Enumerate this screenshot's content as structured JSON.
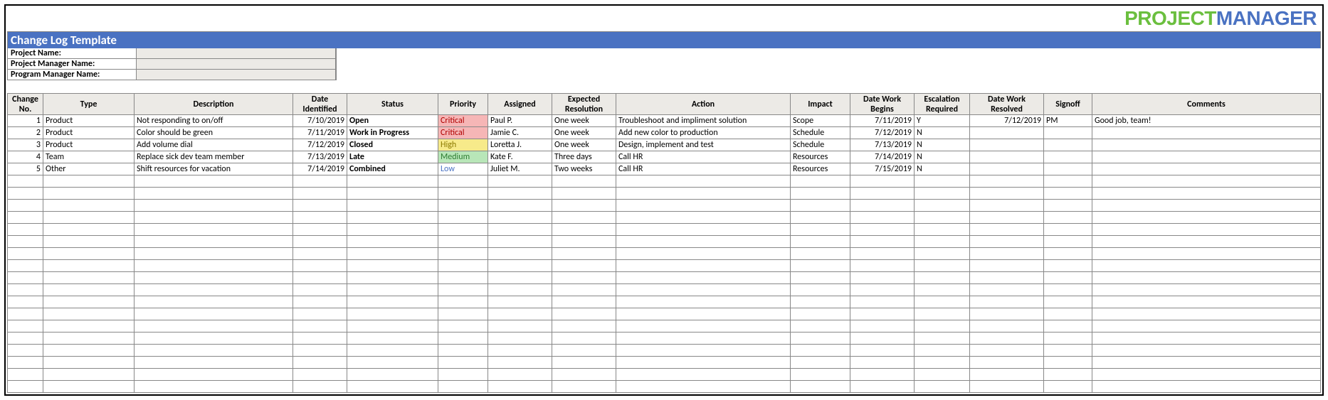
{
  "brand": {
    "part1": "PROJECT",
    "part2": "MANAGER"
  },
  "title": "Change Log Template",
  "meta": {
    "project_label": "Project Name:",
    "project_value": "",
    "pm_label": "Project Manager Name:",
    "pm_value": "",
    "program_label": "Program Manager Name:",
    "program_value": ""
  },
  "headers": {
    "change_no": "Change No.",
    "type": "Type",
    "description": "Description",
    "date_identified": "Date Identified",
    "status": "Status",
    "priority": "Priority",
    "assigned": "Assigned",
    "expected_resolution": "Expected Resolution",
    "action": "Action",
    "impact": "Impact",
    "date_work_begins": "Date Work Begins",
    "escalation_required": "Escalation Required",
    "date_work_resolved": "Date Work Resolved",
    "signoff": "Signoff",
    "comments": "Comments"
  },
  "rows": [
    {
      "no": "1",
      "type": "Product",
      "description": "Not responding to on/off",
      "date_identified": "7/10/2019",
      "status": "Open",
      "priority": "Critical",
      "assigned": "Paul P.",
      "expected": "One week",
      "action": "Troubleshoot and impliment solution",
      "impact": "Scope",
      "work_begins": "7/11/2019",
      "escalation": "Y",
      "work_resolved": "7/12/2019",
      "signoff": "PM",
      "comments": "Good job, team!"
    },
    {
      "no": "2",
      "type": "Product",
      "description": "Color should be green",
      "date_identified": "7/11/2019",
      "status": "Work in Progress",
      "priority": "Critical",
      "assigned": "Jamie C.",
      "expected": "One week",
      "action": "Add new color to production",
      "impact": "Schedule",
      "work_begins": "7/12/2019",
      "escalation": "N",
      "work_resolved": "",
      "signoff": "",
      "comments": ""
    },
    {
      "no": "3",
      "type": "Product",
      "description": "Add volume dial",
      "date_identified": "7/12/2019",
      "status": "Closed",
      "priority": "High",
      "assigned": "Loretta J.",
      "expected": "One week",
      "action": "Design, implement and test",
      "impact": "Schedule",
      "work_begins": "7/13/2019",
      "escalation": "N",
      "work_resolved": "",
      "signoff": "",
      "comments": ""
    },
    {
      "no": "4",
      "type": "Team",
      "description": "Replace sick dev team member",
      "date_identified": "7/13/2019",
      "status": "Late",
      "priority": "Medium",
      "assigned": "Kate F.",
      "expected": "Three days",
      "action": "Call HR",
      "impact": "Resources",
      "work_begins": "7/14/2019",
      "escalation": "N",
      "work_resolved": "",
      "signoff": "",
      "comments": ""
    },
    {
      "no": "5",
      "type": "Other",
      "description": "Shift resources for vacation",
      "date_identified": "7/14/2019",
      "status": "Combined",
      "priority": "Low",
      "assigned": "Juliet M.",
      "expected": "Two weeks",
      "action": "Call HR",
      "impact": "Resources",
      "work_begins": "7/15/2019",
      "escalation": "N",
      "work_resolved": "",
      "signoff": "",
      "comments": ""
    }
  ],
  "empty_rows": 18
}
